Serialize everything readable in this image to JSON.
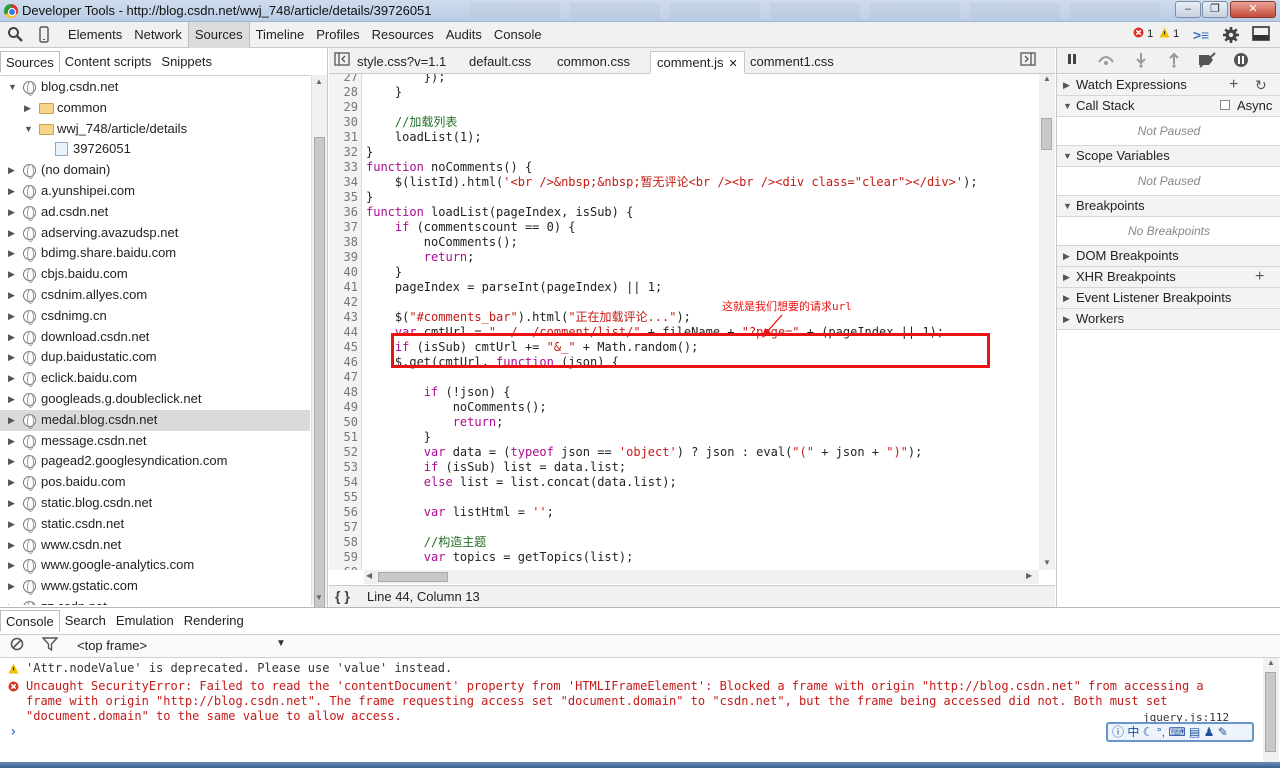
{
  "window": {
    "title": "Developer Tools - http://blog.csdn.net/wwj_748/article/details/39726051",
    "controls": {
      "minimize": "–",
      "maximize": "❐",
      "close": "✕"
    }
  },
  "toolbar": {
    "tabs": [
      "Elements",
      "Network",
      "Sources",
      "Timeline",
      "Profiles",
      "Resources",
      "Audits",
      "Console"
    ],
    "active_tab": "Sources",
    "errors": "1",
    "warnings": "1"
  },
  "navigator": {
    "tabs": [
      "Sources",
      "Content scripts",
      "Snippets"
    ],
    "active_tab": "Sources",
    "tree": [
      {
        "label": "blog.csdn.net",
        "depth": 0,
        "expanded": true,
        "icon": "globe"
      },
      {
        "label": "common",
        "depth": 1,
        "expanded": false,
        "icon": "folder"
      },
      {
        "label": "wwj_748/article/details",
        "depth": 1,
        "expanded": true,
        "icon": "folder"
      },
      {
        "label": "39726051",
        "depth": 2,
        "expanded": null,
        "icon": "document"
      },
      {
        "label": "(no domain)",
        "depth": 0,
        "expanded": false,
        "icon": "globe"
      },
      {
        "label": "a.yunshipei.com",
        "depth": 0,
        "expanded": false,
        "icon": "globe"
      },
      {
        "label": "ad.csdn.net",
        "depth": 0,
        "expanded": false,
        "icon": "globe"
      },
      {
        "label": "adserving.avazudsp.net",
        "depth": 0,
        "expanded": false,
        "icon": "globe"
      },
      {
        "label": "bdimg.share.baidu.com",
        "depth": 0,
        "expanded": false,
        "icon": "globe"
      },
      {
        "label": "cbjs.baidu.com",
        "depth": 0,
        "expanded": false,
        "icon": "globe"
      },
      {
        "label": "csdnim.allyes.com",
        "depth": 0,
        "expanded": false,
        "icon": "globe"
      },
      {
        "label": "csdnimg.cn",
        "depth": 0,
        "expanded": false,
        "icon": "globe"
      },
      {
        "label": "download.csdn.net",
        "depth": 0,
        "expanded": false,
        "icon": "globe"
      },
      {
        "label": "dup.baidustatic.com",
        "depth": 0,
        "expanded": false,
        "icon": "globe"
      },
      {
        "label": "eclick.baidu.com",
        "depth": 0,
        "expanded": false,
        "icon": "globe"
      },
      {
        "label": "googleads.g.doubleclick.net",
        "depth": 0,
        "expanded": false,
        "icon": "globe"
      },
      {
        "label": "medal.blog.csdn.net",
        "depth": 0,
        "expanded": false,
        "icon": "globe",
        "selected": true
      },
      {
        "label": "message.csdn.net",
        "depth": 0,
        "expanded": false,
        "icon": "globe"
      },
      {
        "label": "pagead2.googlesyndication.com",
        "depth": 0,
        "expanded": false,
        "icon": "globe"
      },
      {
        "label": "pos.baidu.com",
        "depth": 0,
        "expanded": false,
        "icon": "globe"
      },
      {
        "label": "static.blog.csdn.net",
        "depth": 0,
        "expanded": false,
        "icon": "globe"
      },
      {
        "label": "static.csdn.net",
        "depth": 0,
        "expanded": false,
        "icon": "globe"
      },
      {
        "label": "www.csdn.net",
        "depth": 0,
        "expanded": false,
        "icon": "globe"
      },
      {
        "label": "www.google-analytics.com",
        "depth": 0,
        "expanded": false,
        "icon": "globe"
      },
      {
        "label": "www.gstatic.com",
        "depth": 0,
        "expanded": false,
        "icon": "globe"
      },
      {
        "label": "zz.csdn.net",
        "depth": 0,
        "expanded": false,
        "icon": "globe"
      }
    ]
  },
  "editor": {
    "tabs": [
      "style.css?v=1.1",
      "default.css",
      "common.css",
      "comment.js",
      "comment1.css"
    ],
    "active_tab": "comment.js",
    "close_glyph": "✕",
    "status": "Line 44, Column 13",
    "pretty_print": "{ }",
    "lines": [
      {
        "n": "27",
        "text": "        });"
      },
      {
        "n": "28",
        "text": "    }"
      },
      {
        "n": "29",
        "text": ""
      },
      {
        "n": "30",
        "text": "    //加载列表",
        "cls": "cmt"
      },
      {
        "n": "31",
        "text": "    loadList(1);"
      },
      {
        "n": "32",
        "text": "}"
      },
      {
        "n": "33",
        "text": "function noComments() {"
      },
      {
        "n": "34",
        "text": "    $(listId).html('<br />&nbsp;&nbsp;暂无评论<br /><br /><div class=\"clear\"></div>');"
      },
      {
        "n": "35",
        "text": "}"
      },
      {
        "n": "36",
        "text": "function loadList(pageIndex, isSub) {"
      },
      {
        "n": "37",
        "text": "    if (commentscount == 0) {"
      },
      {
        "n": "38",
        "text": "        noComments();"
      },
      {
        "n": "39",
        "text": "        return;"
      },
      {
        "n": "40",
        "text": "    }"
      },
      {
        "n": "41",
        "text": "    pageIndex = parseInt(pageIndex) || 1;"
      },
      {
        "n": "42",
        "text": ""
      },
      {
        "n": "43",
        "text": "    $(\"#comments_bar\").html(\"正在加载评论...\");"
      },
      {
        "n": "44",
        "text": "    var cmtUrl = \"../../comment/list/\" + fileName + \"?page=\" + (pageIndex || 1);"
      },
      {
        "n": "45",
        "text": "    if (isSub) cmtUrl += \"&_\" + Math.random();"
      },
      {
        "n": "46",
        "text": "    $.get(cmtUrl, function (json) {"
      },
      {
        "n": "47",
        "text": ""
      },
      {
        "n": "48",
        "text": "        if (!json) {"
      },
      {
        "n": "49",
        "text": "            noComments();"
      },
      {
        "n": "50",
        "text": "            return;"
      },
      {
        "n": "51",
        "text": "        }"
      },
      {
        "n": "52",
        "text": "        var data = (typeof json == 'object') ? json : eval(\"(\" + json + \")\");"
      },
      {
        "n": "53",
        "text": "        if (isSub) list = data.list;"
      },
      {
        "n": "54",
        "text": "        else list = list.concat(data.list);"
      },
      {
        "n": "55",
        "text": ""
      },
      {
        "n": "56",
        "text": "        var listHtml = '';"
      },
      {
        "n": "57",
        "text": ""
      },
      {
        "n": "58",
        "text": "        //构造主题",
        "cls": "cmt"
      },
      {
        "n": "59",
        "text": "        var topics = getTopics(list);"
      },
      {
        "n": "60",
        "text": ""
      }
    ],
    "annotation": "这就是我们想要的请求url"
  },
  "sidebar": {
    "sections": [
      {
        "label": "Watch Expressions",
        "expanded": false
      },
      {
        "label": "Call Stack",
        "expanded": true,
        "checkbox": "Async",
        "empty": "Not Paused"
      },
      {
        "label": "Scope Variables",
        "expanded": true,
        "empty": "Not Paused"
      },
      {
        "label": "Breakpoints",
        "expanded": true,
        "empty": "No Breakpoints"
      },
      {
        "label": "DOM Breakpoints",
        "expanded": false
      },
      {
        "label": "XHR Breakpoints",
        "expanded": false
      },
      {
        "label": "Event Listener Breakpoints",
        "expanded": false
      },
      {
        "label": "Workers",
        "expanded": false
      }
    ]
  },
  "drawer": {
    "tabs": [
      "Console",
      "Search",
      "Emulation",
      "Rendering"
    ],
    "active_tab": "Console",
    "frame_selector": "<top frame>",
    "messages": [
      {
        "level": "warning",
        "lines": [
          "'Attr.nodeValue' is deprecated. Please use 'value' instead."
        ]
      },
      {
        "level": "error",
        "lines": [
          "Uncaught SecurityError: Failed to read the 'contentDocument' property from 'HTMLIFrameElement': Blocked a frame with origin \"http://blog.csdn.net\" from accessing a",
          "frame with origin \"http://blog.csdn.net\". The frame requesting access set \"document.domain\" to \"csdn.net\", but the frame being accessed did not. Both must set",
          "\"document.domain\" to the same value to allow access."
        ],
        "source": "jquery.js:112"
      }
    ],
    "prompt": "›"
  },
  "ime": {
    "label": "中"
  },
  "colors": {
    "error": "#c51a1a",
    "warning": "#e8b400",
    "highlight": "#ee1111",
    "keyword": "#aa0d91",
    "string": "#c41a16",
    "comment": "#236e25"
  }
}
